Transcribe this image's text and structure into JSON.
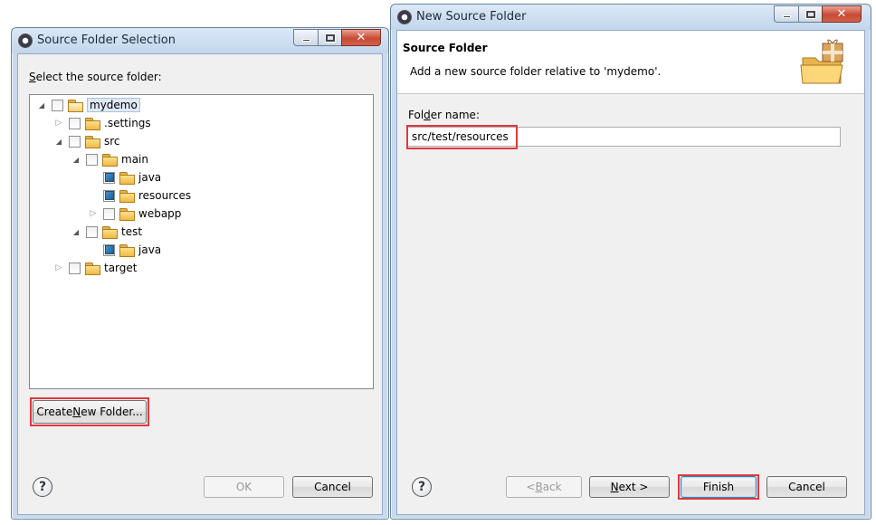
{
  "left_dialog": {
    "title": "Source Folder Selection",
    "prompt_pre": "",
    "prompt_mnemonic": "S",
    "prompt_post": "elect the source folder:",
    "tree": [
      {
        "label": "mydemo",
        "depth": 0,
        "expanded": true,
        "checked": false,
        "selected": true
      },
      {
        "label": ".settings",
        "depth": 1,
        "expanded": false,
        "checked": false
      },
      {
        "label": "src",
        "depth": 1,
        "expanded": true,
        "checked": false
      },
      {
        "label": "main",
        "depth": 2,
        "expanded": true,
        "checked": false
      },
      {
        "label": "java",
        "depth": 3,
        "expanded": null,
        "checked": true
      },
      {
        "label": "resources",
        "depth": 3,
        "expanded": null,
        "checked": true
      },
      {
        "label": "webapp",
        "depth": 3,
        "expanded": false,
        "checked": false
      },
      {
        "label": "test",
        "depth": 2,
        "expanded": true,
        "checked": false
      },
      {
        "label": "java",
        "depth": 3,
        "expanded": null,
        "checked": true
      },
      {
        "label": "target",
        "depth": 1,
        "expanded": false,
        "checked": false
      }
    ],
    "create_button": {
      "pre": "Create ",
      "mnemonic": "N",
      "post": "ew Folder..."
    },
    "ok_label": "OK",
    "cancel_label": "Cancel",
    "help_glyph": "?"
  },
  "right_dialog": {
    "title": "New Source Folder",
    "banner_title": "Source Folder",
    "banner_desc": "Add a new source folder relative to 'mydemo'.",
    "folder_label": {
      "pre": "Fol",
      "mnemonic": "d",
      "post": "er name:"
    },
    "folder_value": "src/test/resources",
    "back_button": {
      "pre": "< ",
      "mnemonic": "B",
      "post": "ack"
    },
    "next_button": {
      "pre": "",
      "mnemonic": "N",
      "post": "ext >"
    },
    "finish_label": "Finish",
    "cancel_label": "Cancel",
    "help_glyph": "?"
  },
  "colors": {
    "highlight_box": "#e0393e",
    "window_frame": "#c7daef",
    "dialog_bg": "#f0f0f0"
  }
}
